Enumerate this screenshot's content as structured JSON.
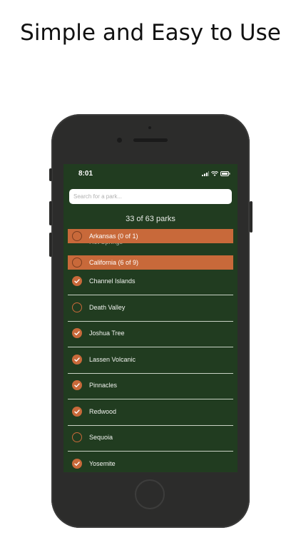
{
  "headline": "Simple and Easy to Use",
  "status_bar": {
    "time": "8:01",
    "icons": [
      "signal-icon",
      "wifi-icon",
      "battery-icon"
    ]
  },
  "search": {
    "placeholder": "Search for a park...",
    "value": ""
  },
  "park_count": "33 of 63 parks",
  "ghost_item": "Hot Springs",
  "sections": [
    {
      "label": "Arkansas (0 of 1)",
      "checked": false
    },
    {
      "label": "California (6 of 9)",
      "checked": false
    }
  ],
  "parks": [
    {
      "name": "Channel Islands",
      "visited": true
    },
    {
      "name": "Death Valley",
      "visited": false
    },
    {
      "name": "Joshua Tree",
      "visited": true
    },
    {
      "name": "Lassen Volcanic",
      "visited": true
    },
    {
      "name": "Pinnacles",
      "visited": true
    },
    {
      "name": "Redwood",
      "visited": true
    },
    {
      "name": "Sequoia",
      "visited": false
    },
    {
      "name": "Yosemite",
      "visited": true
    }
  ],
  "colors": {
    "screen_background": "#213c20",
    "accent": "#c8693a",
    "divider": "#c9d2c4"
  }
}
